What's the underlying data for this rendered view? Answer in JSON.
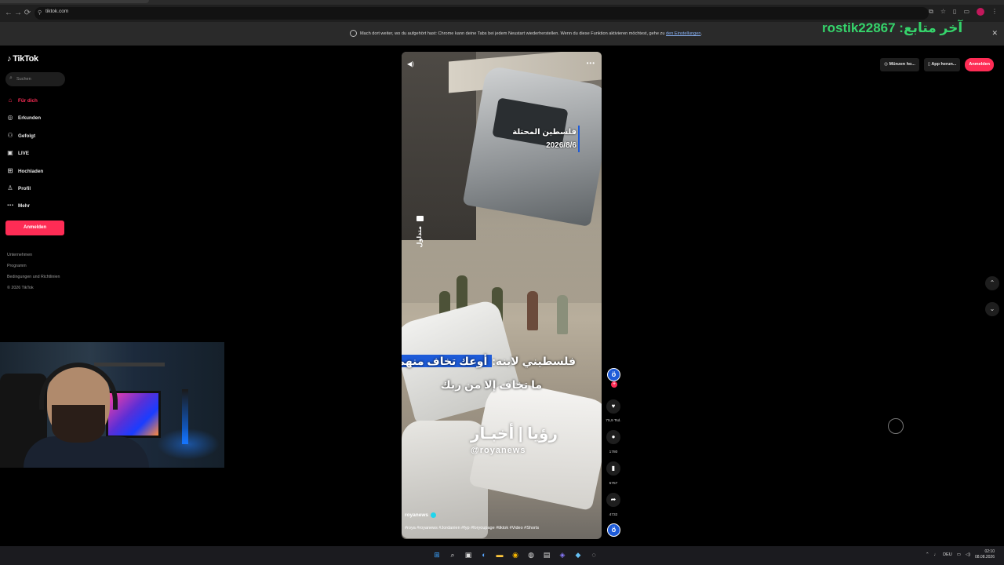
{
  "browser": {
    "url": "tiktok.com",
    "infobar_text": "Mach dort weiter, wo du aufgehört hast: Chrome kann deine Tabs bei jedem Neustart wiederherstellen. Wenn du diese Funktion aktivieren möchtest, gehe zu",
    "infobar_link": "den Einstellungen",
    "infobar_end": "."
  },
  "overlay": {
    "last_follower": "rostik22867 :آخر متابع"
  },
  "sidebar": {
    "logo": "TikTok",
    "search_placeholder": "Suchen",
    "items": [
      {
        "label": "Für dich",
        "icon": "home-icon"
      },
      {
        "label": "Erkunden",
        "icon": "compass-icon"
      },
      {
        "label": "Gefolgt",
        "icon": "following-icon"
      },
      {
        "label": "LIVE",
        "icon": "live-icon"
      },
      {
        "label": "Hochladen",
        "icon": "upload-icon"
      },
      {
        "label": "Profil",
        "icon": "profile-icon"
      },
      {
        "label": "Mehr",
        "icon": "more-icon"
      }
    ],
    "login_label": "Anmelden",
    "footer": [
      "Unternehmen",
      "Programm",
      "Bedingungen und Richtlinien",
      "© 2026 TikTok"
    ]
  },
  "video": {
    "location_line1": "فلسطين المحتلة",
    "location_line2": "2026/8/6",
    "side_label": "متداول",
    "caption_line1_plain": "فلسطيني لابنه:",
    "caption_line1_highlight": " أوعك تخاف منهم..",
    "caption_line2": "ما تخاف إلا من ربك",
    "watermark_arabic": "رؤيا | أخبـار",
    "watermark_handle": "@royanews",
    "author": "royanews",
    "hashtags": "#roya #royanews #Jordanien #fyp #foryoupage #tiktok #Video #Shorts"
  },
  "actions": {
    "likes": "75,9 Tsd.",
    "comments": "1780",
    "saves": "5757",
    "shares": "4732"
  },
  "top_actions": {
    "coins": "Münzen ho...",
    "app": "App herun...",
    "login": "Anmelden"
  },
  "taskbar": {
    "lang": "DEU",
    "time": "02:10",
    "date": "08.08.2026"
  }
}
